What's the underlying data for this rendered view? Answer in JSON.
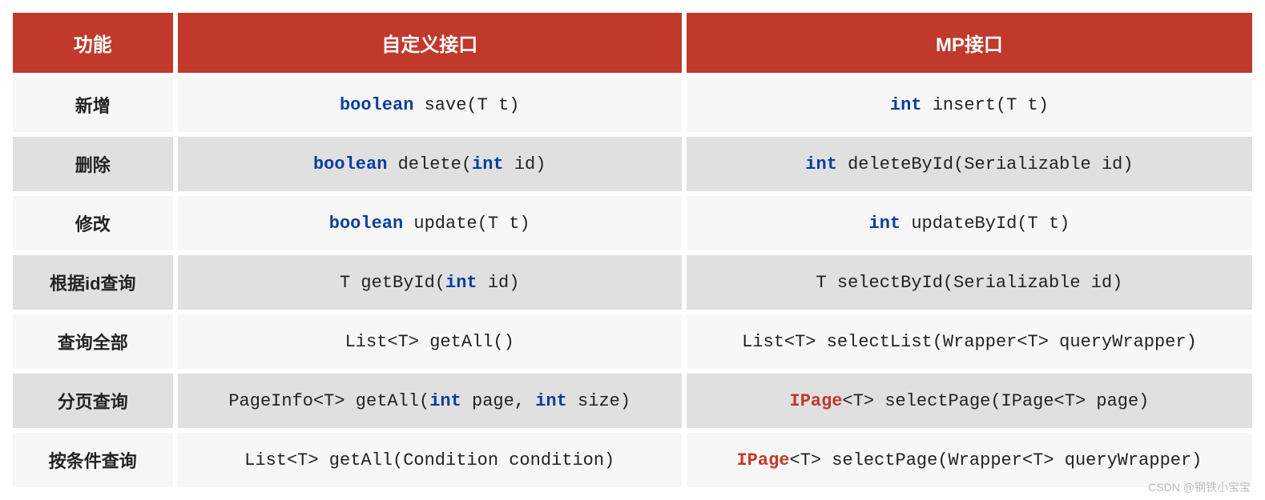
{
  "headers": {
    "fn": "功能",
    "custom": "自定义接口",
    "mp": "MP接口"
  },
  "rows": [
    {
      "label": "新增",
      "custom": [
        [
          "kw",
          "boolean"
        ],
        [
          "txt",
          " save(T t)"
        ]
      ],
      "mp": [
        [
          "kw",
          "int"
        ],
        [
          "txt",
          " insert(T t)"
        ]
      ]
    },
    {
      "label": "删除",
      "custom": [
        [
          "kw",
          "boolean"
        ],
        [
          "txt",
          " delete("
        ],
        [
          "kw",
          "int"
        ],
        [
          "txt",
          " id)"
        ]
      ],
      "mp": [
        [
          "kw",
          "int"
        ],
        [
          "txt",
          " deleteById(Serializable id)"
        ]
      ]
    },
    {
      "label": "修改",
      "custom": [
        [
          "kw",
          "boolean"
        ],
        [
          "txt",
          " update(T t)"
        ]
      ],
      "mp": [
        [
          "kw",
          "int"
        ],
        [
          "txt",
          " updateById(T t)"
        ]
      ]
    },
    {
      "label": "根据id查询",
      "custom": [
        [
          "txt",
          "T getById("
        ],
        [
          "kw",
          "int"
        ],
        [
          "txt",
          " id)"
        ]
      ],
      "mp": [
        [
          "txt",
          "T selectById(Serializable id)"
        ]
      ]
    },
    {
      "label": "查询全部",
      "custom": [
        [
          "txt",
          "List<T> getAll()"
        ]
      ],
      "mp": [
        [
          "txt",
          "List<T> selectList(Wrapper<T> queryWrapper)"
        ]
      ]
    },
    {
      "label": "分页查询",
      "custom": [
        [
          "txt",
          "PageInfo<T> getAll("
        ],
        [
          "kw",
          "int"
        ],
        [
          "txt",
          " page, "
        ],
        [
          "kw",
          "int"
        ],
        [
          "txt",
          " size)"
        ]
      ],
      "mp": [
        [
          "cls",
          "IPage"
        ],
        [
          "txt",
          "<T> selectPage(IPage<T> page)"
        ]
      ]
    },
    {
      "label": "按条件查询",
      "custom": [
        [
          "txt",
          "List<T> getAll(Condition condition)"
        ]
      ],
      "mp": [
        [
          "cls",
          "IPage"
        ],
        [
          "txt",
          "<T> selectPage(Wrapper<T> queryWrapper)"
        ]
      ]
    }
  ],
  "watermark": "CSDN @钢铁小宝宝"
}
